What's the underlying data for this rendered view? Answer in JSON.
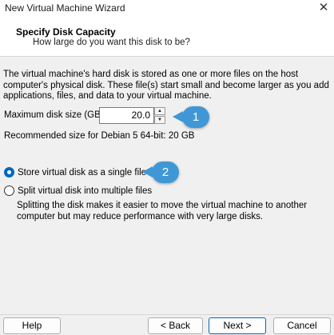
{
  "window": {
    "title": "New Virtual Machine Wizard",
    "close_glyph": "✕"
  },
  "header": {
    "title": "Specify Disk Capacity",
    "subtitle": "How large do you want this disk to be?"
  },
  "description": "The virtual machine's hard disk is stored as one or more files on the host computer's physical disk. These file(s) start small and become larger as you add applications, files, and data to your virtual machine.",
  "disk_size": {
    "label": "Maximum disk size (GB):",
    "value": "20.0",
    "spin_up": "▲",
    "spin_down": "▼"
  },
  "recommended": "Recommended size for Debian 5 64-bit: 20 GB",
  "options": {
    "single_file": "Store virtual disk as a single file",
    "split_files": "Split virtual disk into multiple files",
    "selected": "single_file",
    "split_help": "Splitting the disk makes it easier to move the virtual machine to another computer but may reduce performance with very large disks."
  },
  "callouts": {
    "one": "1",
    "two": "2",
    "color": "#3f97d6"
  },
  "buttons": {
    "help": "Help",
    "back": "< Back",
    "next": "Next >",
    "cancel": "Cancel"
  }
}
